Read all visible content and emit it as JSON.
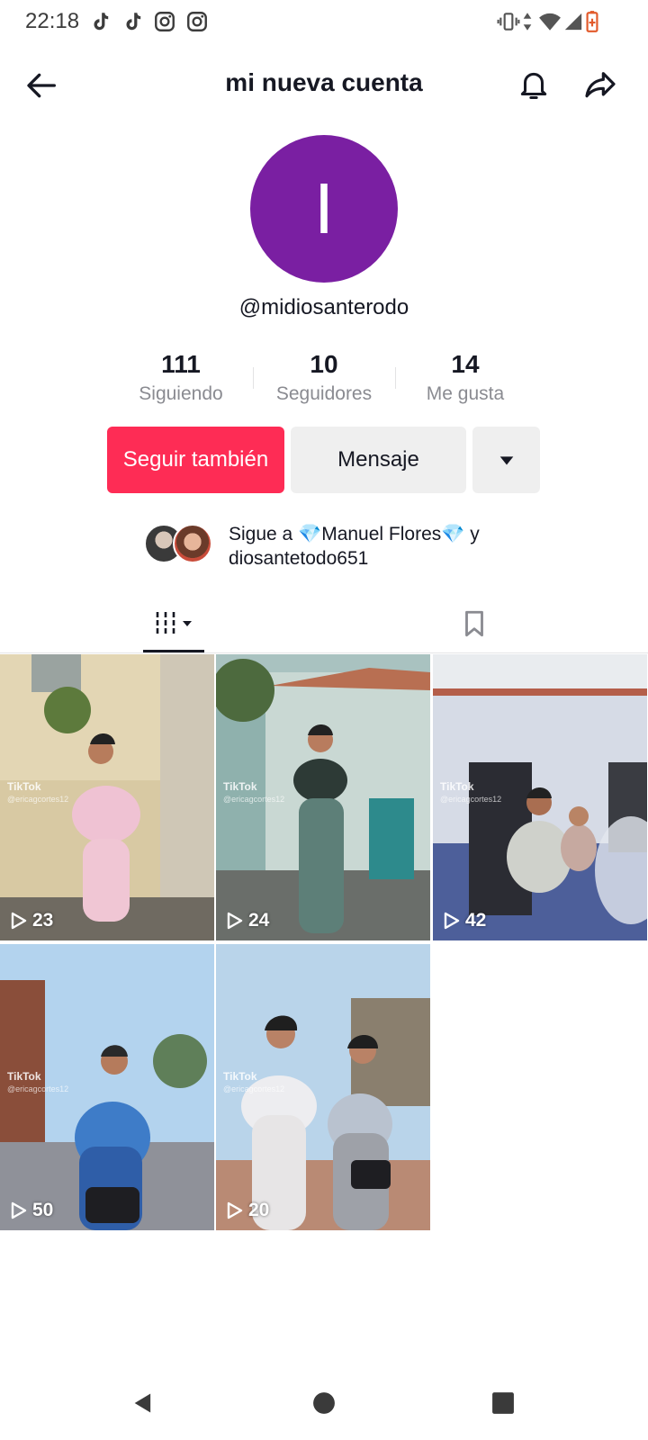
{
  "status_bar": {
    "time": "22:18",
    "app_icons": [
      "tiktok-icon",
      "tiktok-icon",
      "instagram-icon",
      "instagram-icon"
    ],
    "right_icons": [
      "vibrate-icon",
      "data-arrows-icon",
      "wifi-icon",
      "signal-icon",
      "battery-icon"
    ]
  },
  "header": {
    "title": "mi nueva cuenta",
    "back_icon": "arrow-left-icon",
    "bell_icon": "bell-icon",
    "share_icon": "share-icon"
  },
  "profile": {
    "avatar_letter": "I",
    "avatar_color": "#7a1fa2",
    "username": "@midiosanterodo"
  },
  "stats": [
    {
      "value": "111",
      "label": "Siguiendo"
    },
    {
      "value": "10",
      "label": "Seguidores"
    },
    {
      "value": "14",
      "label": "Me gusta"
    }
  ],
  "actions": {
    "follow_label": "Seguir también",
    "follow_color": "#fe2c55",
    "message_label": "Mensaje",
    "more_icon": "caret-down-icon"
  },
  "mutual": {
    "prefix": "Sigue a ",
    "name": "💎Manuel Flores💎",
    "connector": " y",
    "second": "diosantetodo651"
  },
  "tabs": [
    {
      "icon": "videos-grid-icon",
      "active": true
    },
    {
      "icon": "bookmark-icon",
      "active": false
    }
  ],
  "videos": [
    {
      "views": "23",
      "watermark": "TikTok",
      "handle": "@ericagcortes12"
    },
    {
      "views": "24",
      "watermark": "TikTok",
      "handle": "@ericagcortes12"
    },
    {
      "views": "42",
      "watermark": "TikTok",
      "handle": "@ericagcortes12"
    },
    {
      "views": "50",
      "watermark": "TikTok",
      "handle": "@ericagcortes12"
    },
    {
      "views": "20",
      "watermark": "TikTok",
      "handle": "@ericagcortes12"
    }
  ],
  "nav": [
    "back-triangle-icon",
    "home-circle-icon",
    "recents-square-icon"
  ]
}
